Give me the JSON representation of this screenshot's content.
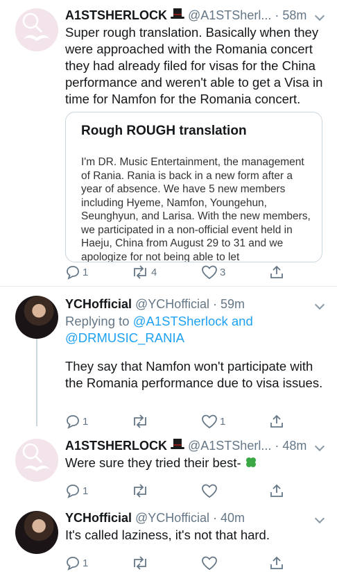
{
  "tweets": [
    {
      "name": "A1STSHERLOCK",
      "handle": "@A1STSherl... · 58m",
      "text": "Super rough translation. Basically when they were approached with the Romania concert they had already filed for visas for the China performance and weren't able to get a Visa in time for Namfon for the Romania concert.",
      "card": {
        "title": "Rough ROUGH translation",
        "body": "I'm DR. Music Entertainment, the management of Rania. Rania is back in a new form after a year of absence. We have 5 new members including Hyeme, Namfon, Youngehun, Seunghyun, and Larisa. With the new members, we participated in a non-official event held in Haeju, China from August 29 to 31 and we apologize for not being able to let"
      },
      "replies": "1",
      "retweets": "4",
      "likes": "3"
    },
    {
      "name": "YCHofficial",
      "handle": "@YCHofficial · 59m",
      "replying_prefix": "Replying to ",
      "replying_user1": "@A1STSherlock",
      "replying_and": " and",
      "replying_user2": "@DRMUSIC_RANIA",
      "text": "They say that Namfon won't participate with the Romania performance due to visa issues.",
      "replies": "1",
      "retweets": "",
      "likes": "1"
    },
    {
      "name": "A1STSHERLOCK",
      "handle": "@A1STSherl... · 48m",
      "text": "Were sure they tried their best-",
      "emoji": "four-leaf-clover",
      "replies": "1",
      "retweets": "",
      "likes": ""
    },
    {
      "name": "YCHofficial",
      "handle": "@YCHofficial · 40m",
      "text": "It's called laziness, it's not that hard.",
      "replies": "1",
      "retweets": "",
      "likes": ""
    }
  ],
  "colors": {
    "text": "#14171a",
    "muted": "#657786",
    "link": "#1da1f2",
    "border": "#ccd6dd",
    "clover": "#3aa845"
  }
}
